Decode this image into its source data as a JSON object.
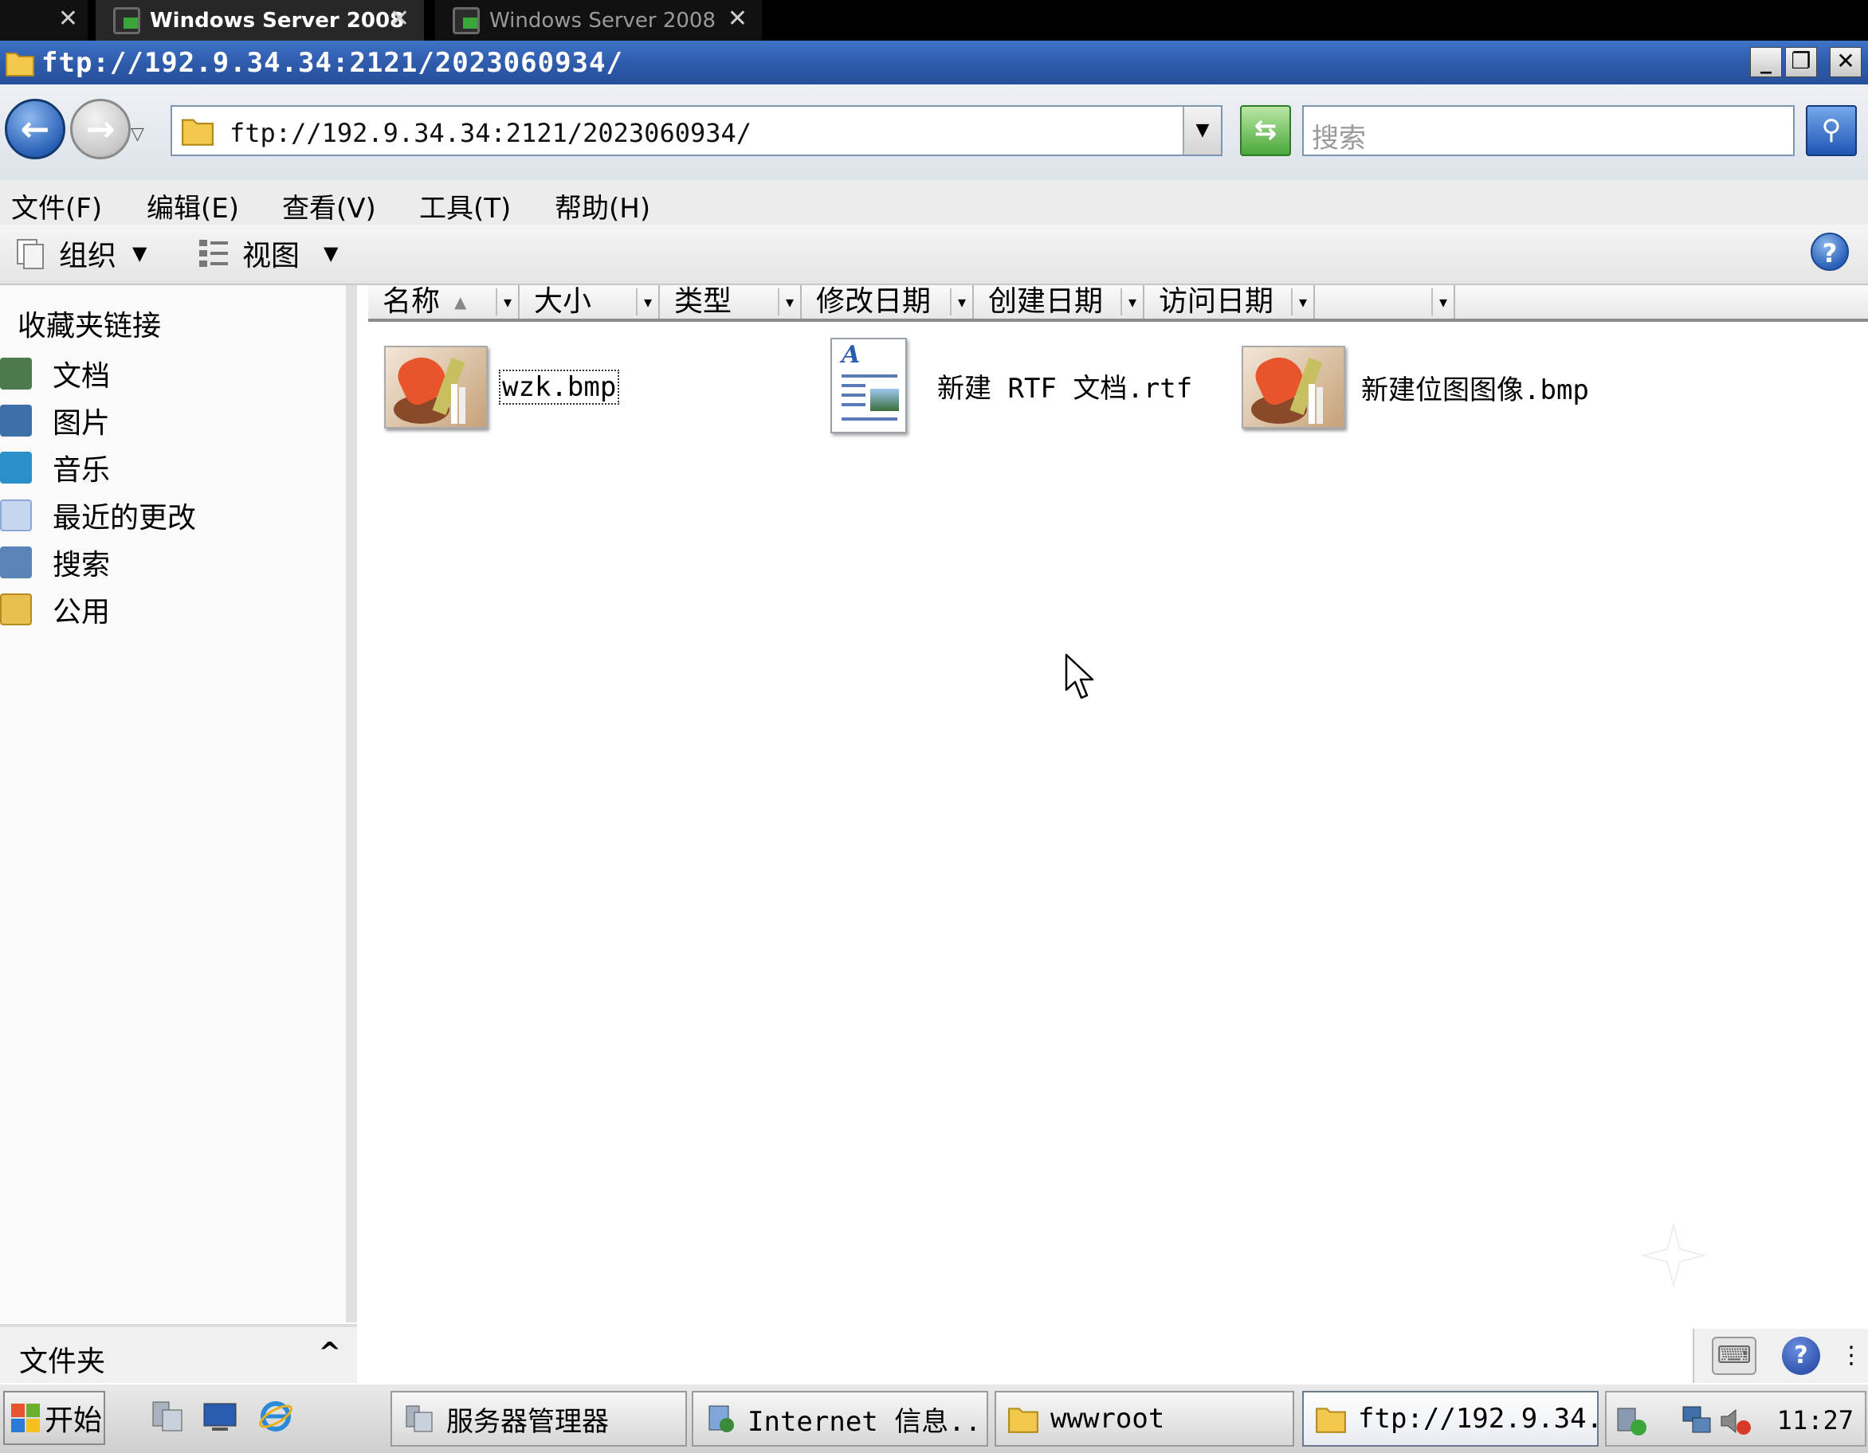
{
  "vm_tabs": [
    {
      "label": "Windows Server 2008",
      "close": "✕"
    },
    {
      "label": "Windows Server 2008",
      "close": "✕"
    }
  ],
  "vm_tab_ghost_close": "✕",
  "window": {
    "title": "ftp://192.9.34.34:2121/2023060934/",
    "minimize": "_",
    "restore": "❐",
    "close": "✕"
  },
  "navbar": {
    "back_glyph": "←",
    "forward_glyph": "→",
    "recent_glyph": "▽",
    "address": "ftp://192.9.34.34:2121/2023060934/",
    "address_dropdown": "▼",
    "go_glyph": "⇆",
    "search_placeholder": "搜索",
    "search_glyph": "⚲"
  },
  "menu": [
    {
      "label": "文件(F)"
    },
    {
      "label": "编辑(E)"
    },
    {
      "label": "查看(V)"
    },
    {
      "label": "工具(T)"
    },
    {
      "label": "帮助(H)"
    }
  ],
  "toolbar": {
    "organize": "组织",
    "views": "视图",
    "caret": "▼",
    "help": "?"
  },
  "left_pane": {
    "header": "收藏夹链接",
    "items": [
      {
        "label": "文档",
        "icon": "documents-icon",
        "color": "#4c7a4c"
      },
      {
        "label": "图片",
        "icon": "pictures-icon",
        "color": "#3f6fa8"
      },
      {
        "label": "音乐",
        "icon": "music-icon",
        "color": "#2b8fc8"
      },
      {
        "label": "最近的更改",
        "icon": "recent-changes-icon",
        "color": "#8aa8d8"
      },
      {
        "label": "搜索",
        "icon": "search-folder-icon",
        "color": "#5a84b8"
      },
      {
        "label": "公用",
        "icon": "public-folder-icon",
        "color": "#e8c050"
      }
    ],
    "folders_label": "文件夹",
    "folders_toggle": "^"
  },
  "columns": [
    {
      "label": "名称",
      "sort": "▲"
    },
    {
      "label": "大小"
    },
    {
      "label": "类型"
    },
    {
      "label": "修改日期"
    },
    {
      "label": "创建日期"
    },
    {
      "label": "访问日期"
    },
    {
      "label": ""
    }
  ],
  "column_dropdown": "▾",
  "files": [
    {
      "name": "wzk.bmp",
      "icon": "bitmap-image-icon",
      "selected": true
    },
    {
      "name": "新建 RTF 文档.rtf",
      "icon": "rtf-document-icon",
      "selected": false
    },
    {
      "name": "新建位图图像.bmp",
      "icon": "bitmap-image-icon",
      "selected": false
    }
  ],
  "tray_panel": {
    "keyboard_glyph": "⌨",
    "help_glyph": "?",
    "more_glyph": "⋮"
  },
  "taskbar": {
    "start": "开始",
    "tasks": [
      {
        "label": "服务器管理器",
        "icon": "server-manager-icon"
      },
      {
        "label": "Internet 信息...",
        "icon": "iis-manager-icon"
      },
      {
        "label": "wwwroot",
        "icon": "folder-icon"
      },
      {
        "label": "ftp://192.9.34...",
        "icon": "folder-icon",
        "active": true
      }
    ],
    "clock": "11:27"
  }
}
